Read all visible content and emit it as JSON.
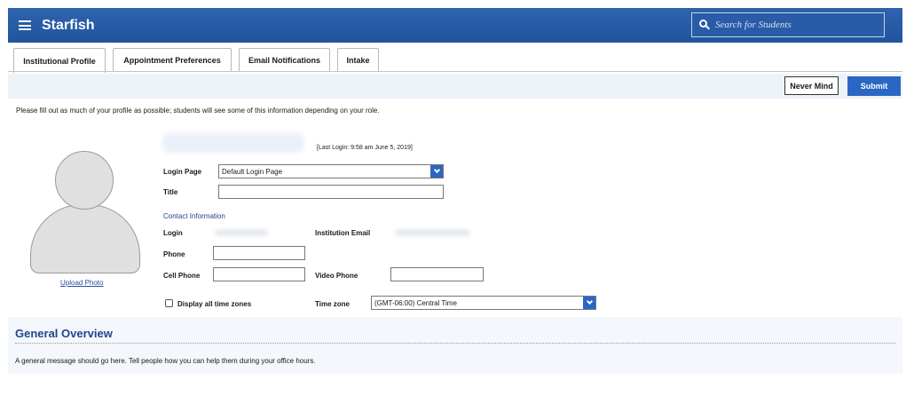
{
  "header": {
    "app_title": "Starfish",
    "menu_icon": "hamburger-menu-icon",
    "search_icon": "search-icon",
    "search_placeholder": "Search for Students",
    "bar_color": "#2a5ba6"
  },
  "tabs": [
    {
      "label": "Institutional Profile",
      "active": true
    },
    {
      "label": "Appointment Preferences",
      "active": false
    },
    {
      "label": "Email Notifications",
      "active": false
    },
    {
      "label": "Intake",
      "active": false
    }
  ],
  "actions": {
    "never_mind": "Never Mind",
    "submit": "Submit",
    "submit_color": "#2a67c4"
  },
  "intro_text": "Please fill out as much of your profile as possible; students will see some of this information depending on your role.",
  "profile": {
    "upload_photo": "Upload Photo",
    "last_login": "[Last Login: 9:58 am June 5, 2019]",
    "login_page_label": "Login Page",
    "login_page_value": "Default Login Page",
    "title_label": "Title",
    "title_value": ""
  },
  "contact": {
    "heading": "Contact Information",
    "login_label": "Login",
    "institution_email_label": "Institution Email",
    "phone_label": "Phone",
    "phone_value": "",
    "cell_phone_label": "Cell Phone",
    "cell_phone_value": "",
    "video_phone_label": "Video Phone",
    "video_phone_value": "",
    "display_all_tz_label": "Display all time zones",
    "display_all_tz_checked": false,
    "time_zone_label": "Time zone",
    "time_zone_value": "(GMT-06:00) Central Time"
  },
  "overview": {
    "title": "General Overview",
    "message": "A general message should go here. Tell people how you can help them during your office hours."
  }
}
